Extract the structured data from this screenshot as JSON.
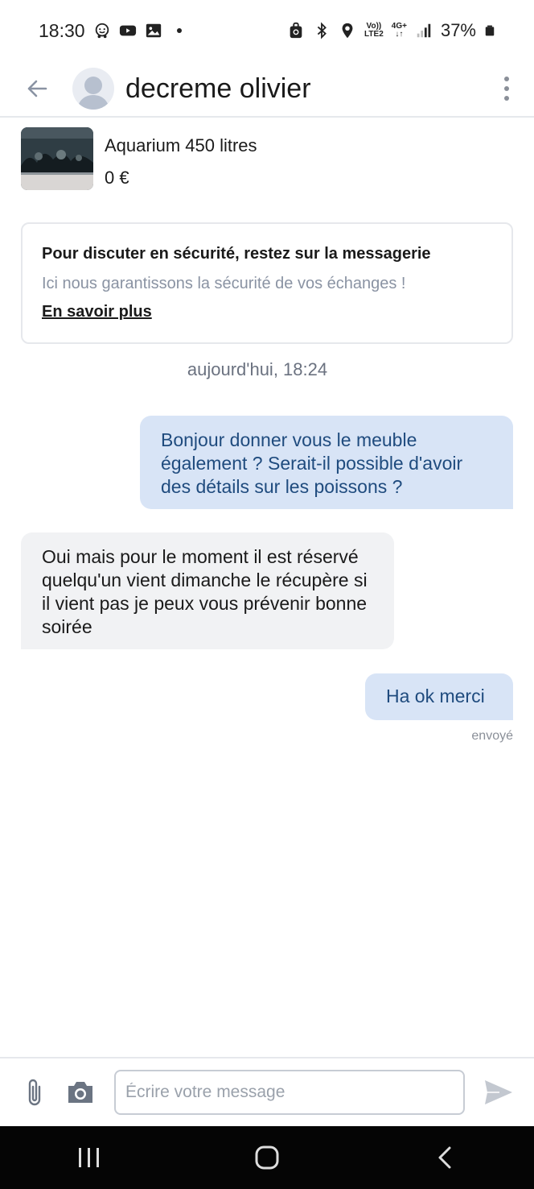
{
  "status_bar": {
    "time": "18:30",
    "battery": "37%",
    "network_top": "Vo))",
    "network_bottom": "LTE2",
    "net2_top": "4G+"
  },
  "header": {
    "contact_name": "decreme olivier",
    "icons": [
      "back-arrow-icon",
      "avatar-placeholder-icon",
      "more-vertical-icon"
    ]
  },
  "listing": {
    "title": "Aquarium 450 litres",
    "price": "0 €"
  },
  "safety_notice": {
    "title": "Pour discuter en sécurité, restez sur la messagerie",
    "subtitle": "Ici nous garantissons la sécurité de vos échanges !",
    "link": "En savoir plus"
  },
  "conversation": {
    "date_separator": "aujourd'hui, 18:24",
    "messages": [
      {
        "direction": "out",
        "text": "Bonjour donner vous le meuble également ? Serait-il possible d'avoir des détails sur les poissons ?"
      },
      {
        "direction": "in",
        "text": "Oui mais pour le moment il est réservé quelqu'un vient dimanche le récupère si il vient pas je peux vous prévenir bonne soirée"
      },
      {
        "direction": "out",
        "text": "Ha ok merci"
      }
    ],
    "last_status": "envoyé"
  },
  "composer": {
    "placeholder": "Écrire votre message",
    "value": ""
  },
  "colors": {
    "outgoing_bubble": "#d8e4f6",
    "outgoing_text": "#1f4b7e",
    "incoming_bubble": "#f1f2f4",
    "nav_bar": "#050505"
  }
}
